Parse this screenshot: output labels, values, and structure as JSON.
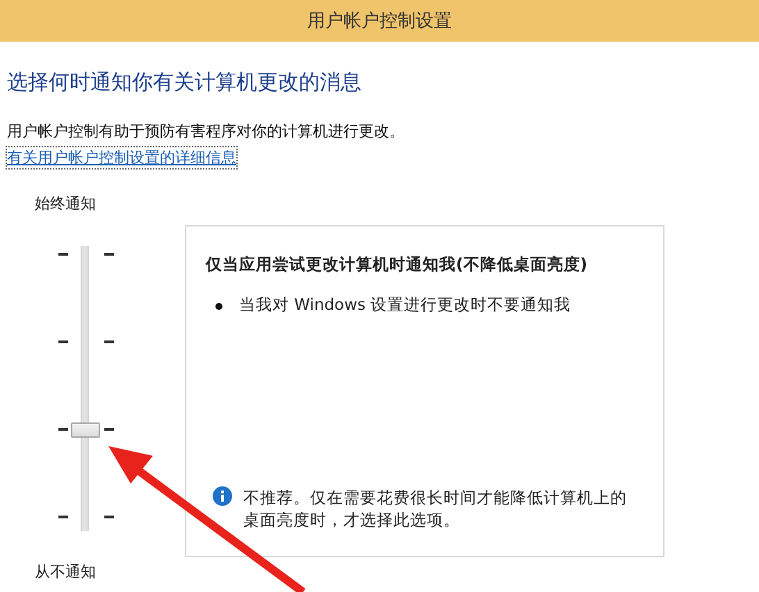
{
  "window": {
    "title": "用户帐户控制设置"
  },
  "heading": "选择何时通知你有关计算机更改的消息",
  "description": "用户帐户控制有助于预防有害程序对你的计算机进行更改。",
  "help_link": "有关用户帐户控制设置的详细信息",
  "slider": {
    "top_label": "始终通知",
    "bottom_label": "从不通知",
    "level": 0.333
  },
  "panel": {
    "title": "仅当应用尝试更改计算机时通知我(不降低桌面亮度)",
    "bullets": [
      "当我对 Windows 设置进行更改时不要通知我"
    ],
    "note": "不推荐。仅在需要花费很长时间才能降低计算机上的桌面亮度时，才选择此选项。"
  }
}
